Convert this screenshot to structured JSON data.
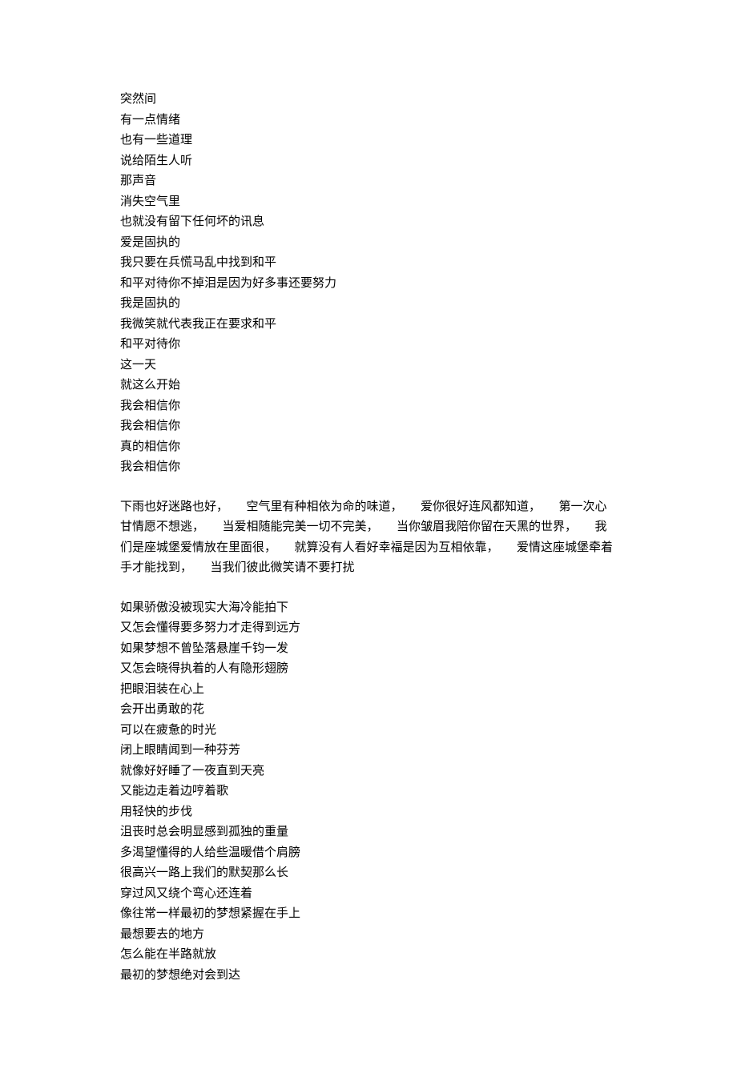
{
  "block1": [
    "突然间",
    "有一点情绪",
    "也有一些道理",
    "说给陌生人听",
    "那声音",
    "消失空气里",
    "也就没有留下任何坏的讯息",
    "爱是固执的",
    "我只要在兵慌马乱中找到和平",
    "和平对待你不掉泪是因为好多事还要努力",
    "我是固执的",
    "我微笑就代表我正在要求和平",
    "和平对待你",
    "这一天",
    "就这么开始",
    "我会相信你",
    "我会相信你",
    "真的相信你",
    "我会相信你"
  ],
  "block2": "下雨也好迷路也好，　　空气里有种相依为命的味道，　　爱你很好连风都知道，　　第一次心甘情愿不想逃，　　当爱相随能完美一切不完美，　　当你皱眉我陪你留在天黑的世界，　　我们是座城堡爱情放在里面很，　　就算没有人看好幸福是因为互相依靠，　　爱情这座城堡牵着手才能找到，　　当我们彼此微笑请不要打扰",
  "block3": [
    "如果骄傲没被现实大海冷能拍下",
    "又怎会懂得要多努力才走得到远方",
    "如果梦想不曾坠落悬崖千钧一发",
    "又怎会晓得执着的人有隐形翅膀",
    "把眼泪装在心上",
    "会开出勇敢的花",
    "可以在疲惫的时光",
    "闭上眼睛闻到一种芬芳",
    "就像好好睡了一夜直到天亮",
    "又能边走着边哼着歌",
    "用轻快的步伐",
    "沮丧时总会明显感到孤独的重量",
    "多渴望懂得的人给些温暖借个肩膀",
    "很高兴一路上我们的默契那么长",
    "穿过风又绕个弯心还连着",
    "像往常一样最初的梦想紧握在手上",
    "最想要去的地方",
    "怎么能在半路就放",
    "最初的梦想绝对会到达"
  ]
}
